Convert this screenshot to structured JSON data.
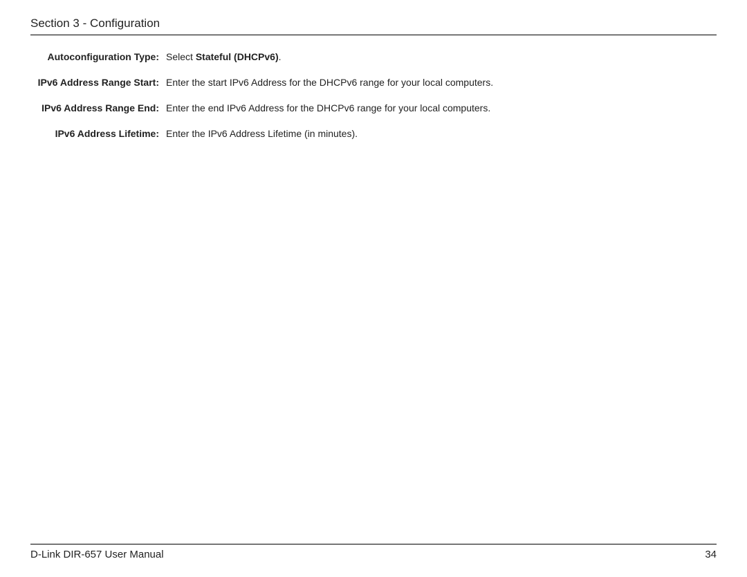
{
  "header": {
    "section_title": "Section 3 - Configuration"
  },
  "definitions": [
    {
      "label": "Autoconfiguration Type:",
      "value_lead": "Select ",
      "value_strong": "Stateful (DHCPv6)",
      "value_tail": "."
    },
    {
      "label": "IPv6 Address Range Start:",
      "value_lead": "Enter the start IPv6 Address for the DHCPv6 range for your local computers.",
      "value_strong": "",
      "value_tail": ""
    },
    {
      "label": "IPv6 Address Range End:",
      "value_lead": "Enter the end IPv6 Address for the DHCPv6 range for your local computers.",
      "value_strong": "",
      "value_tail": ""
    },
    {
      "label": "IPv6 Address Lifetime:",
      "value_lead": "Enter the IPv6 Address Lifetime (in minutes).",
      "value_strong": "",
      "value_tail": ""
    }
  ],
  "footer": {
    "manual_title": "D-Link DIR-657 User Manual",
    "page_number": "34"
  }
}
